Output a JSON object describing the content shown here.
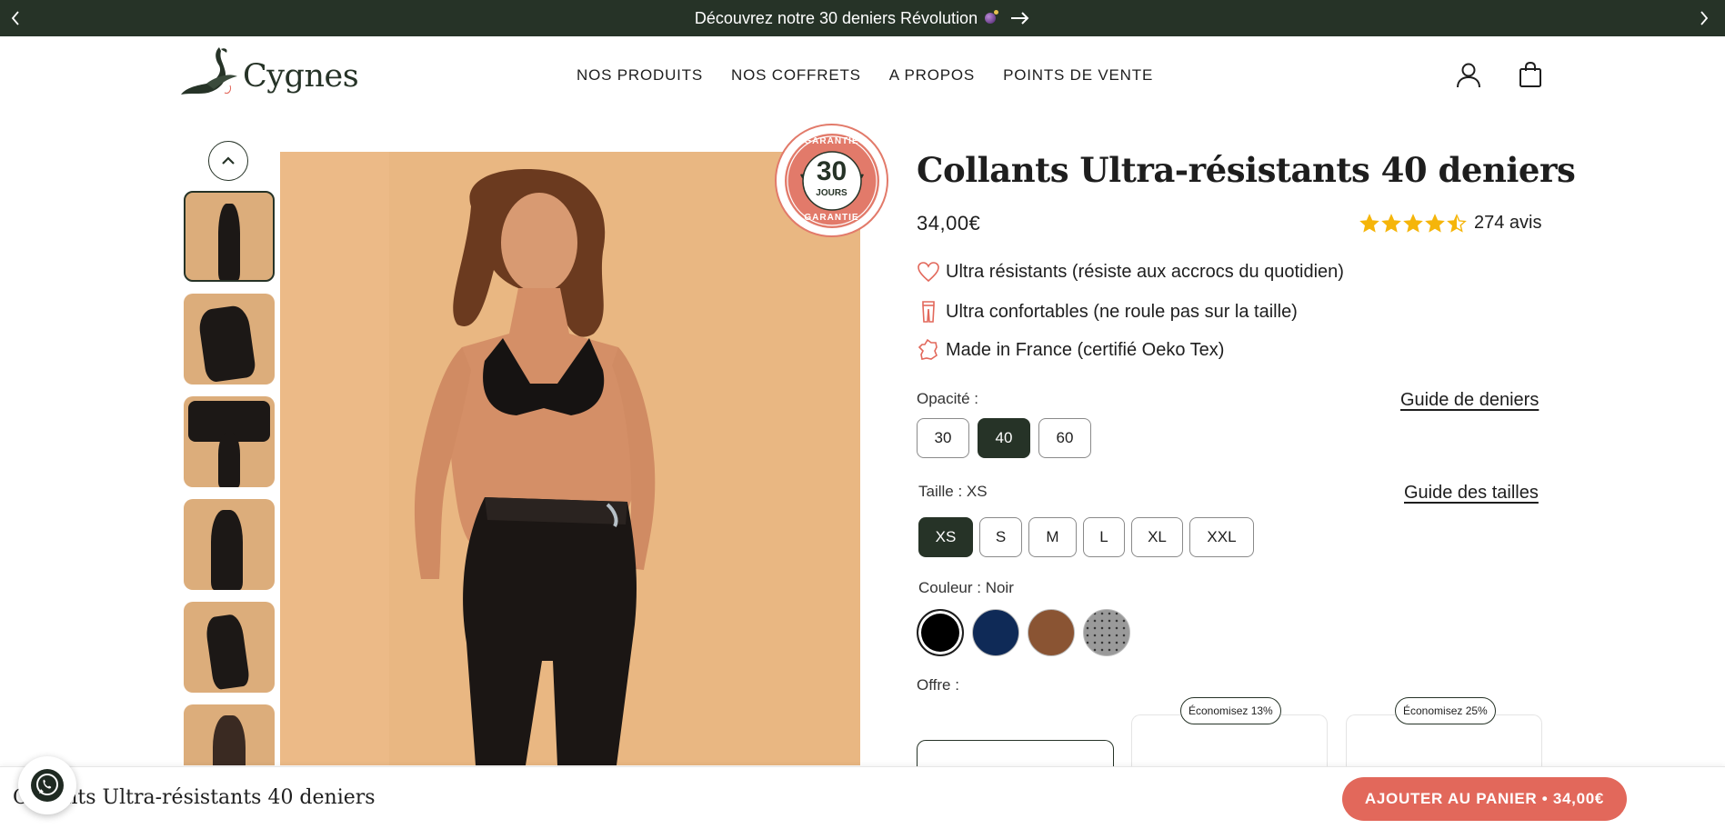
{
  "announcement": {
    "text": "Découvrez notre 30 deniers Révolution",
    "prev_icon": "chevron-left-icon",
    "next_icon": "chevron-right-icon"
  },
  "header": {
    "logo_text": "Cygnes",
    "nav": [
      "NOS PRODUITS",
      "NOS COFFRETS",
      "A PROPOS",
      "POINTS DE VENTE"
    ],
    "icons": [
      "account-icon",
      "bag-icon"
    ]
  },
  "gallery": {
    "thumbnail_count": 6,
    "badge": {
      "top": "GARANTIE",
      "number": "30",
      "unit": "JOURS",
      "bottom": "GARANTIE"
    }
  },
  "product": {
    "title": "Collants Ultra-résistants 40 deniers",
    "price": "34,00€",
    "rating": 4.5,
    "reviews": "274 avis",
    "features": [
      "Ultra résistants (résiste aux accrocs du quotidien)",
      "Ultra confortables (ne roule pas sur la taille)",
      "Made in France (certifié Oeko Tex)"
    ],
    "opacity": {
      "label": "Opacité :",
      "guide": "Guide de deniers",
      "options": [
        "30",
        "40",
        "60"
      ],
      "selected": "40"
    },
    "size": {
      "label": "Taille : XS",
      "guide": "Guide des tailles",
      "options": [
        "XS",
        "S",
        "M",
        "L",
        "XL",
        "XXL"
      ],
      "selected": "XS"
    },
    "color": {
      "label": "Couleur : Noir",
      "swatches": [
        "#000000",
        "#0f2a57",
        "#8a5433",
        "#9a9a9a"
      ]
    },
    "offer": {
      "label": "Offre :",
      "savings": [
        "Économisez 13%",
        "Économisez 25%"
      ]
    }
  },
  "sticky": {
    "title": "Collants Ultra-résistants 40 deniers",
    "button": "AJOUTER AU PANIER • 34,00€"
  },
  "colors": {
    "dark_green": "#263327",
    "accent_coral": "#e2685b",
    "star": "#f5b50a"
  }
}
